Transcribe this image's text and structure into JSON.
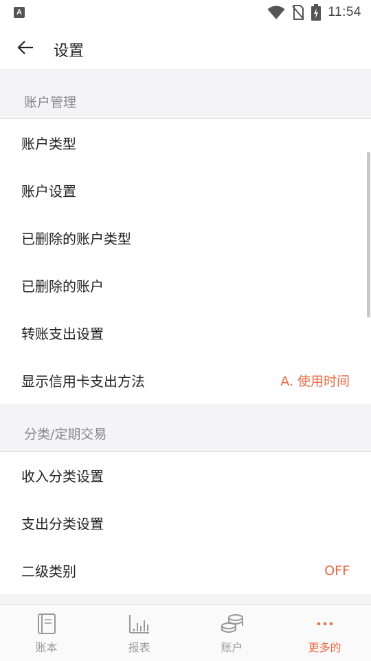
{
  "status_bar": {
    "time": "11:54",
    "left_icon_letter": "A"
  },
  "header": {
    "title": "设置"
  },
  "sections": [
    {
      "title": "账户管理",
      "items": [
        {
          "label": "账户类型",
          "value": ""
        },
        {
          "label": "账户设置",
          "value": ""
        },
        {
          "label": "已删除的账户类型",
          "value": ""
        },
        {
          "label": "已删除的账户",
          "value": ""
        },
        {
          "label": "转账支出设置",
          "value": ""
        },
        {
          "label": "显示信用卡支出方法",
          "value": "A. 使用时间"
        }
      ]
    },
    {
      "title": "分类/定期交易",
      "items": [
        {
          "label": "收入分类设置",
          "value": ""
        },
        {
          "label": "支出分类设置",
          "value": ""
        },
        {
          "label": "二级类别",
          "value": "OFF"
        }
      ]
    }
  ],
  "bottom_nav": [
    {
      "label": "账本",
      "icon": "book-icon",
      "active": false
    },
    {
      "label": "报表",
      "icon": "bar-chart-icon",
      "active": false
    },
    {
      "label": "账户",
      "icon": "coins-icon",
      "active": false
    },
    {
      "label": "更多的",
      "icon": "more-dots-icon",
      "active": true
    }
  ],
  "colors": {
    "accent": "#f4673f",
    "section_text": "#888888",
    "background": "#f4f4f6"
  }
}
